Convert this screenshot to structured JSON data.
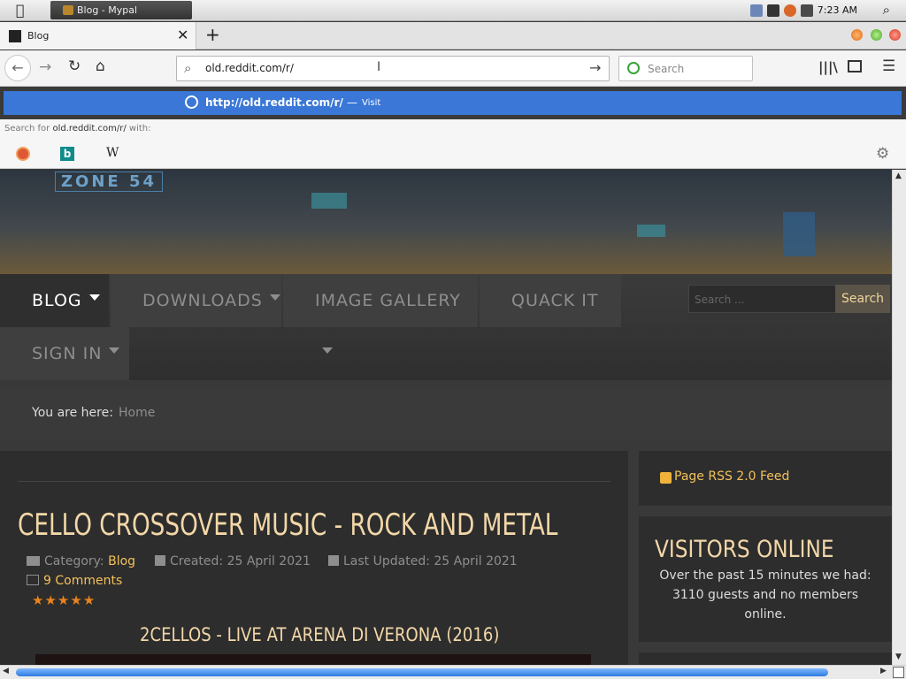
{
  "system": {
    "app_name": "Blog - Mypal",
    "clock": "7:23 AM"
  },
  "browser": {
    "tab_title": "Blog",
    "url": "old.reddit.com/r/",
    "search_placeholder": "Search",
    "suggestion_url": "http://old.reddit.com/r/",
    "suggestion_sep": "—",
    "suggestion_action": "Visit",
    "search_for_prefix": "Search for",
    "search_for_query": "old.reddit.com/r/",
    "search_for_suffix": "with:",
    "engines": [
      "duckduckgo-icon",
      "bing-icon",
      "wikipedia-icon"
    ],
    "accent": "#3a77d6"
  },
  "site": {
    "menu": [
      "BLOG",
      "DOWNLOADS",
      "IMAGE GALLERY",
      "QUACK IT",
      "SIGN IN"
    ],
    "search_placeholder": "Search ...",
    "search_button": "Search",
    "breadcrumb_label": "You are here:",
    "breadcrumb_home": "Home",
    "article": {
      "title": "CELLO CROSSOVER MUSIC - ROCK AND METAL",
      "category_label": "Category:",
      "category": "Blog",
      "created": "Created: 25 April 2021",
      "updated": "Last Updated: 25 April 2021",
      "comments": "9 Comments",
      "rating_stars": 5,
      "video_title": "2CELLOS - LIVE AT ARENA DI VERONA (2016)"
    },
    "rss_label": "Page RSS 2.0 Feed",
    "visitors_title": "VISITORS ONLINE",
    "visitors_text": "Over the past 15 minutes we had: 3110 guests and no members online.",
    "banner_text": "ZONE 54",
    "accent": "#f3c15a",
    "title_color": "#f3d7a8"
  }
}
